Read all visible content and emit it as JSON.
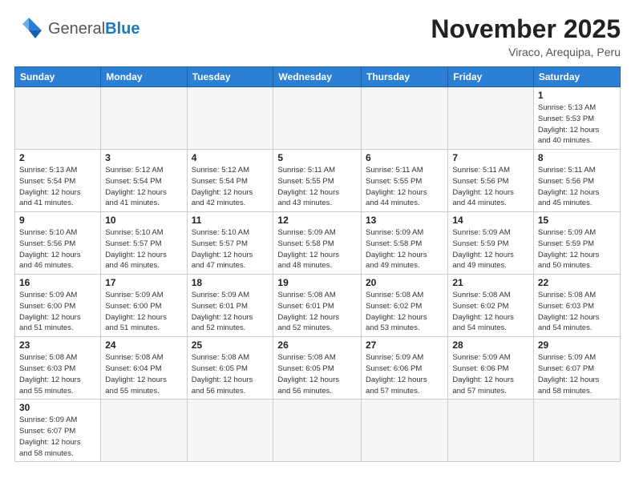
{
  "logo": {
    "general": "General",
    "blue": "Blue"
  },
  "title": "November 2025",
  "location": "Viraco, Arequipa, Peru",
  "days_header": [
    "Sunday",
    "Monday",
    "Tuesday",
    "Wednesday",
    "Thursday",
    "Friday",
    "Saturday"
  ],
  "weeks": [
    [
      {
        "day": "",
        "info": ""
      },
      {
        "day": "",
        "info": ""
      },
      {
        "day": "",
        "info": ""
      },
      {
        "day": "",
        "info": ""
      },
      {
        "day": "",
        "info": ""
      },
      {
        "day": "",
        "info": ""
      },
      {
        "day": "1",
        "info": "Sunrise: 5:13 AM\nSunset: 5:53 PM\nDaylight: 12 hours\nand 40 minutes."
      }
    ],
    [
      {
        "day": "2",
        "info": "Sunrise: 5:13 AM\nSunset: 5:54 PM\nDaylight: 12 hours\nand 41 minutes."
      },
      {
        "day": "3",
        "info": "Sunrise: 5:12 AM\nSunset: 5:54 PM\nDaylight: 12 hours\nand 41 minutes."
      },
      {
        "day": "4",
        "info": "Sunrise: 5:12 AM\nSunset: 5:54 PM\nDaylight: 12 hours\nand 42 minutes."
      },
      {
        "day": "5",
        "info": "Sunrise: 5:11 AM\nSunset: 5:55 PM\nDaylight: 12 hours\nand 43 minutes."
      },
      {
        "day": "6",
        "info": "Sunrise: 5:11 AM\nSunset: 5:55 PM\nDaylight: 12 hours\nand 44 minutes."
      },
      {
        "day": "7",
        "info": "Sunrise: 5:11 AM\nSunset: 5:56 PM\nDaylight: 12 hours\nand 44 minutes."
      },
      {
        "day": "8",
        "info": "Sunrise: 5:11 AM\nSunset: 5:56 PM\nDaylight: 12 hours\nand 45 minutes."
      }
    ],
    [
      {
        "day": "9",
        "info": "Sunrise: 5:10 AM\nSunset: 5:56 PM\nDaylight: 12 hours\nand 46 minutes."
      },
      {
        "day": "10",
        "info": "Sunrise: 5:10 AM\nSunset: 5:57 PM\nDaylight: 12 hours\nand 46 minutes."
      },
      {
        "day": "11",
        "info": "Sunrise: 5:10 AM\nSunset: 5:57 PM\nDaylight: 12 hours\nand 47 minutes."
      },
      {
        "day": "12",
        "info": "Sunrise: 5:09 AM\nSunset: 5:58 PM\nDaylight: 12 hours\nand 48 minutes."
      },
      {
        "day": "13",
        "info": "Sunrise: 5:09 AM\nSunset: 5:58 PM\nDaylight: 12 hours\nand 49 minutes."
      },
      {
        "day": "14",
        "info": "Sunrise: 5:09 AM\nSunset: 5:59 PM\nDaylight: 12 hours\nand 49 minutes."
      },
      {
        "day": "15",
        "info": "Sunrise: 5:09 AM\nSunset: 5:59 PM\nDaylight: 12 hours\nand 50 minutes."
      }
    ],
    [
      {
        "day": "16",
        "info": "Sunrise: 5:09 AM\nSunset: 6:00 PM\nDaylight: 12 hours\nand 51 minutes."
      },
      {
        "day": "17",
        "info": "Sunrise: 5:09 AM\nSunset: 6:00 PM\nDaylight: 12 hours\nand 51 minutes."
      },
      {
        "day": "18",
        "info": "Sunrise: 5:09 AM\nSunset: 6:01 PM\nDaylight: 12 hours\nand 52 minutes."
      },
      {
        "day": "19",
        "info": "Sunrise: 5:08 AM\nSunset: 6:01 PM\nDaylight: 12 hours\nand 52 minutes."
      },
      {
        "day": "20",
        "info": "Sunrise: 5:08 AM\nSunset: 6:02 PM\nDaylight: 12 hours\nand 53 minutes."
      },
      {
        "day": "21",
        "info": "Sunrise: 5:08 AM\nSunset: 6:02 PM\nDaylight: 12 hours\nand 54 minutes."
      },
      {
        "day": "22",
        "info": "Sunrise: 5:08 AM\nSunset: 6:03 PM\nDaylight: 12 hours\nand 54 minutes."
      }
    ],
    [
      {
        "day": "23",
        "info": "Sunrise: 5:08 AM\nSunset: 6:03 PM\nDaylight: 12 hours\nand 55 minutes."
      },
      {
        "day": "24",
        "info": "Sunrise: 5:08 AM\nSunset: 6:04 PM\nDaylight: 12 hours\nand 55 minutes."
      },
      {
        "day": "25",
        "info": "Sunrise: 5:08 AM\nSunset: 6:05 PM\nDaylight: 12 hours\nand 56 minutes."
      },
      {
        "day": "26",
        "info": "Sunrise: 5:08 AM\nSunset: 6:05 PM\nDaylight: 12 hours\nand 56 minutes."
      },
      {
        "day": "27",
        "info": "Sunrise: 5:09 AM\nSunset: 6:06 PM\nDaylight: 12 hours\nand 57 minutes."
      },
      {
        "day": "28",
        "info": "Sunrise: 5:09 AM\nSunset: 6:06 PM\nDaylight: 12 hours\nand 57 minutes."
      },
      {
        "day": "29",
        "info": "Sunrise: 5:09 AM\nSunset: 6:07 PM\nDaylight: 12 hours\nand 58 minutes."
      }
    ],
    [
      {
        "day": "30",
        "info": "Sunrise: 5:09 AM\nSunset: 6:07 PM\nDaylight: 12 hours\nand 58 minutes."
      },
      {
        "day": "",
        "info": ""
      },
      {
        "day": "",
        "info": ""
      },
      {
        "day": "",
        "info": ""
      },
      {
        "day": "",
        "info": ""
      },
      {
        "day": "",
        "info": ""
      },
      {
        "day": "",
        "info": ""
      }
    ]
  ],
  "empty_rows": [
    0,
    1,
    2,
    3,
    4,
    5
  ]
}
